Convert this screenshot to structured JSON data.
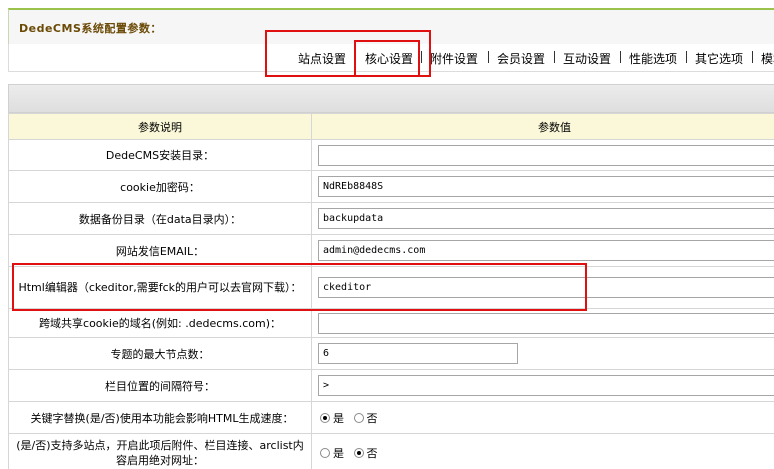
{
  "header": {
    "title": "DedeCMS系统配置参数："
  },
  "tabs": [
    {
      "label": "站点设置"
    },
    {
      "label": "核心设置"
    },
    {
      "label": "附件设置"
    },
    {
      "label": "会员设置"
    },
    {
      "label": "互动设置"
    },
    {
      "label": "性能选项"
    },
    {
      "label": "其它选项"
    },
    {
      "label": "模块设置"
    }
  ],
  "table": {
    "col_label": "参数说明",
    "col_value": "参数值"
  },
  "rows": [
    {
      "label": "DedeCMS安装目录：",
      "value": ""
    },
    {
      "label": "cookie加密码：",
      "value": "NdREb8848S"
    },
    {
      "label": "数据备份目录（在data目录内）：",
      "value": "backupdata"
    },
    {
      "label": "网站发信EMAIL：",
      "value": "admin@dedecms.com"
    },
    {
      "label": "Html编辑器（ckeditor,需要fck的用户可以去官网下载）：",
      "value": "ckeditor"
    },
    {
      "label": "跨域共享cookie的域名(例如: .dedecms.com)：",
      "value": ""
    },
    {
      "label": "专题的最大节点数：",
      "value": "6"
    },
    {
      "label": "栏目位置的间隔符号：",
      "value": ">"
    }
  ],
  "radio_rows": [
    {
      "label": "关键字替换(是/否)使用本功能会影响HTML生成速度：",
      "yes": "是",
      "no": "否",
      "selected": "yes"
    },
    {
      "label": "(是/否)支持多站点，开启此项后附件、栏目连接、arclist内容启用绝对网址：",
      "yes": "是",
      "no": "否",
      "selected": "no"
    }
  ]
}
